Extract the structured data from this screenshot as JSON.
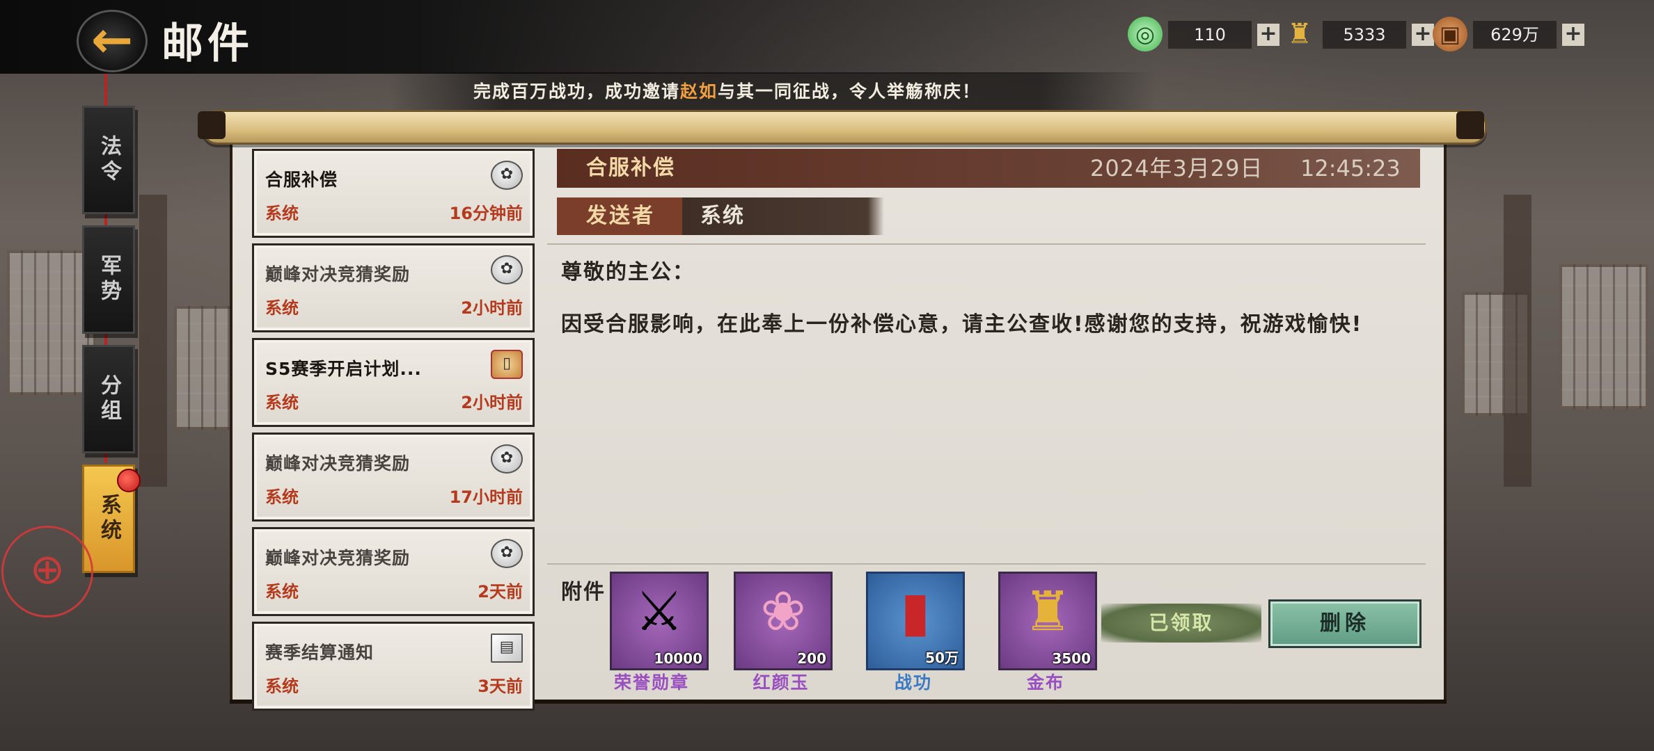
{
  "header": {
    "back_icon": "arrow-left-icon",
    "title": "邮件",
    "resources": [
      {
        "icon": "jade-coin-icon",
        "value": "110"
      },
      {
        "icon": "gold-token-icon",
        "value": "5333"
      },
      {
        "icon": "copper-coin-icon",
        "value": "629万"
      }
    ],
    "plus_symbol": "+"
  },
  "ticker": {
    "prefix": "完成百万战功，成功邀请",
    "highlight": "赵如",
    "suffix": "与其一同征战，令人举觞称庆！"
  },
  "tabs": [
    {
      "label": "法令",
      "active": false
    },
    {
      "label": "军势",
      "active": false
    },
    {
      "label": "分组",
      "active": false
    },
    {
      "label": "系统",
      "active": true
    }
  ],
  "mail_list": [
    {
      "title": "合服补偿",
      "sender": "系统",
      "time": "16分钟前",
      "icon": "pouch-icon"
    },
    {
      "title": "巅峰对决竞猜奖励",
      "sender": "系统",
      "time": "2小时前",
      "icon": "pouch-icon"
    },
    {
      "title": "S5赛季开启计划...",
      "sender": "系统",
      "time": "2小时前",
      "icon": "scroll-icon"
    },
    {
      "title": "巅峰对决竞猜奖励",
      "sender": "系统",
      "time": "17小时前",
      "icon": "pouch-icon"
    },
    {
      "title": "巅峰对决竞猜奖励",
      "sender": "系统",
      "time": "2天前",
      "icon": "pouch-icon"
    },
    {
      "title": "赛季结算通知",
      "sender": "系统",
      "time": "3天前",
      "icon": "letter-icon"
    }
  ],
  "detail": {
    "title": "合服补偿",
    "date": "2024年3月29日",
    "time": "12:45:23",
    "sender_label": "发送者",
    "sender": "系统",
    "greeting": "尊敬的主公：",
    "body": "因受合服影响，在此奉上一份补偿心意，请主公查收!感谢您的支持，祝游戏愉快!",
    "attachments_label": "附件",
    "attachments": [
      {
        "name": "荣誉勋章",
        "qty": "10000",
        "icon": "crossed-swords-icon",
        "name_color": "#9a4fc0"
      },
      {
        "name": "红颜玉",
        "qty": "200",
        "icon": "pink-jade-icon",
        "name_color": "#9a4fc0"
      },
      {
        "name": "战功",
        "qty": "50万",
        "icon": "red-scroll-icon",
        "name_color": "#3a7ac4"
      },
      {
        "name": "金布",
        "qty": "3500",
        "icon": "gold-spade-coin-icon",
        "name_color": "#9a4fc0"
      }
    ],
    "claimed_label": "已领取",
    "delete_label": "删除"
  }
}
